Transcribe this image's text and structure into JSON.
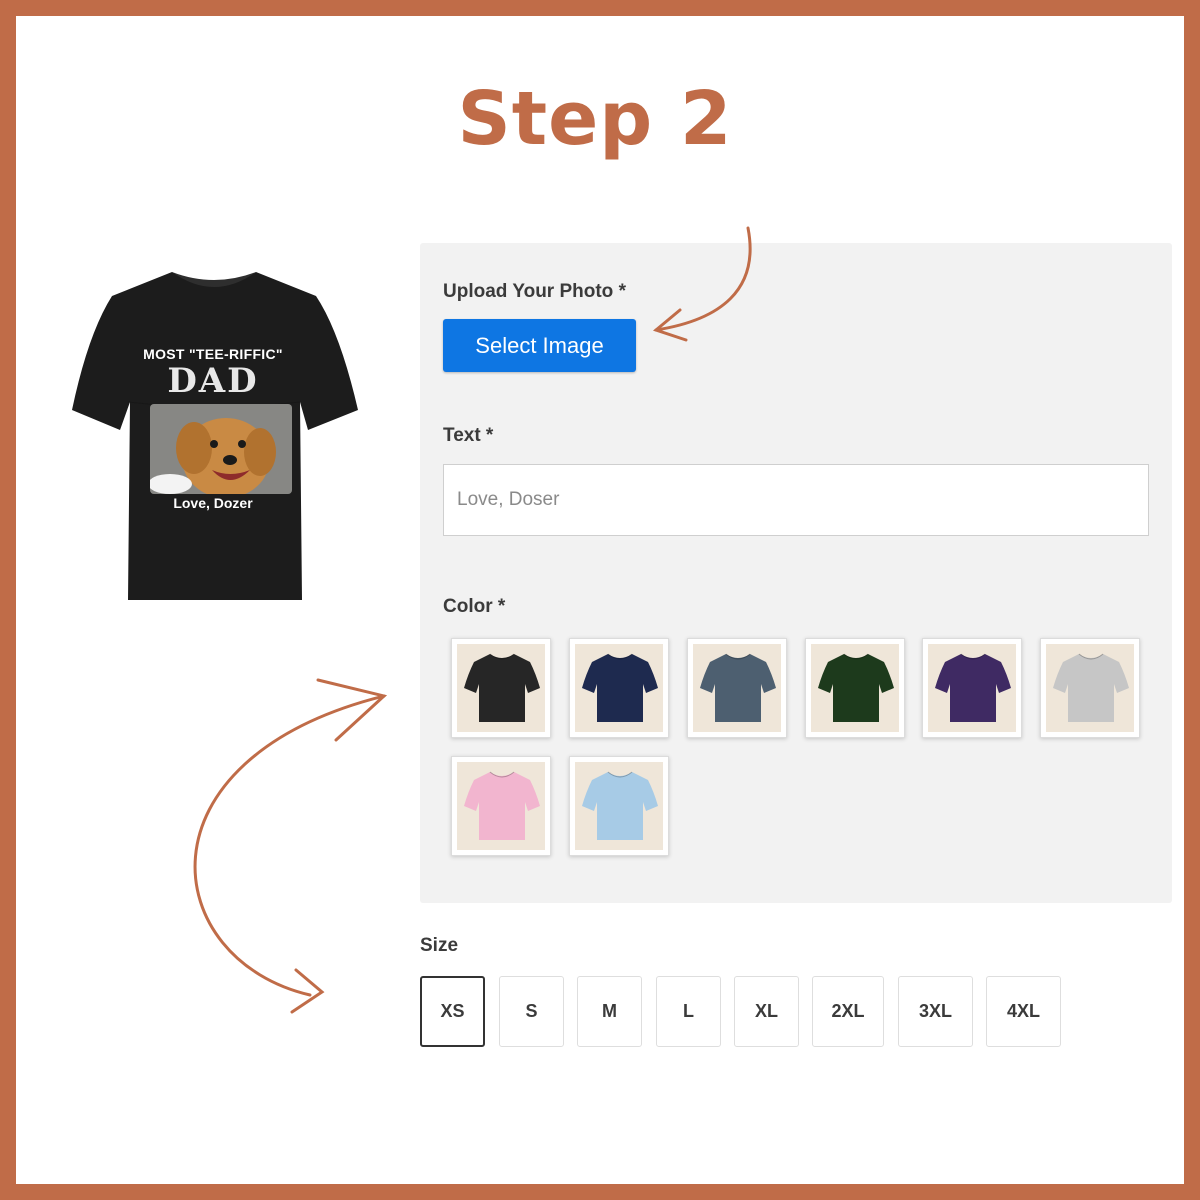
{
  "title": "Step 2",
  "hero_shirt": {
    "line1": "MOST \"TEE-RIFFIC\"",
    "line2": "DAD",
    "caption": "Love, Dozer"
  },
  "upload": {
    "label": "Upload Your Photo *",
    "button_label": "Select Image"
  },
  "text_field": {
    "label": "Text *",
    "placeholder": "Love, Doser"
  },
  "color": {
    "label": "Color *",
    "options": [
      {
        "name": "black-shirt-swatch",
        "hex": "#262626"
      },
      {
        "name": "navy-shirt-swatch",
        "hex": "#1e2a4f"
      },
      {
        "name": "slate-shirt-swatch",
        "hex": "#4d5f70"
      },
      {
        "name": "forest-green-shirt-swatch",
        "hex": "#1d3a1c"
      },
      {
        "name": "purple-shirt-swatch",
        "hex": "#3f2a63"
      },
      {
        "name": "light-gray-shirt-swatch",
        "hex": "#c6c6c6"
      },
      {
        "name": "pink-shirt-swatch",
        "hex": "#f2b5cf"
      },
      {
        "name": "light-blue-shirt-swatch",
        "hex": "#a7cbe6"
      }
    ]
  },
  "size": {
    "label": "Size",
    "options": [
      "XS",
      "S",
      "M",
      "L",
      "XL",
      "2XL",
      "3XL",
      "4XL"
    ],
    "selected": "XS"
  },
  "colors": {
    "accent": "#c06c48",
    "button": "#0e76e3",
    "panel": "#f2f2f2"
  }
}
